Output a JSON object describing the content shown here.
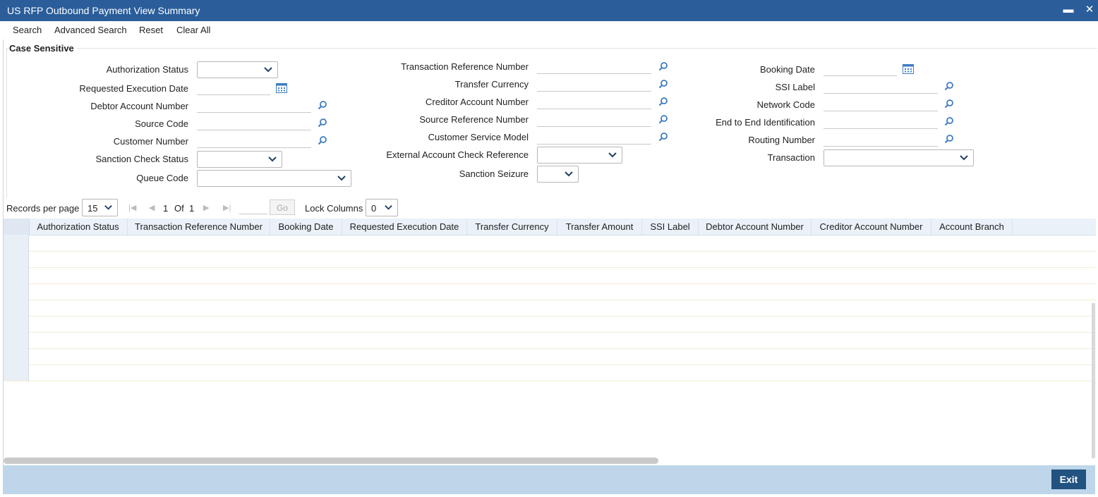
{
  "window": {
    "title": "US RFP Outbound Payment View Summary",
    "minimize": "▬",
    "close": "✕"
  },
  "toolbar": {
    "search": "Search",
    "advanced_search": "Advanced Search",
    "reset": "Reset",
    "clear_all": "Clear All"
  },
  "form": {
    "section_title": "Case Sensitive",
    "col1": {
      "authorization_status": "Authorization Status",
      "requested_execution_date": "Requested Execution Date",
      "debtor_account_number": "Debtor Account Number",
      "source_code": "Source Code",
      "customer_number": "Customer Number",
      "sanction_check_status": "Sanction Check Status",
      "queue_code": "Queue Code"
    },
    "col2": {
      "transaction_reference_number": "Transaction Reference Number",
      "transfer_currency": "Transfer Currency",
      "creditor_account_number": "Creditor Account Number",
      "source_reference_number": "Source Reference Number",
      "customer_service_model": "Customer Service Model",
      "external_account_check_reference": "External Account Check Reference",
      "sanction_seizure": "Sanction Seizure"
    },
    "col3": {
      "booking_date": "Booking Date",
      "ssi_label": "SSI Label",
      "network_code": "Network Code",
      "end_to_end_identification": "End to End Identification",
      "routing_number": "Routing Number",
      "transaction": "Transaction"
    }
  },
  "pager": {
    "records_per_page_label": "Records per page",
    "records_per_page": "15",
    "current_page": "1",
    "of_label": "Of",
    "total_pages": "1",
    "go_label": "Go",
    "lock_columns_label": "Lock Columns",
    "lock_columns": "0"
  },
  "grid": {
    "columns": [
      "Authorization Status",
      "Transaction Reference Number",
      "Booking Date",
      "Requested Execution Date",
      "Transfer Currency",
      "Transfer Amount",
      "SSI Label",
      "Debtor Account Number",
      "Creditor Account Number",
      "Account Branch"
    ],
    "rows": 9
  },
  "footer": {
    "exit": "Exit"
  },
  "colors": {
    "titlebar": "#2a5d9a",
    "footer": "#bfd6ea",
    "exit_button": "#22527f",
    "icon": "#3e7cc2"
  }
}
